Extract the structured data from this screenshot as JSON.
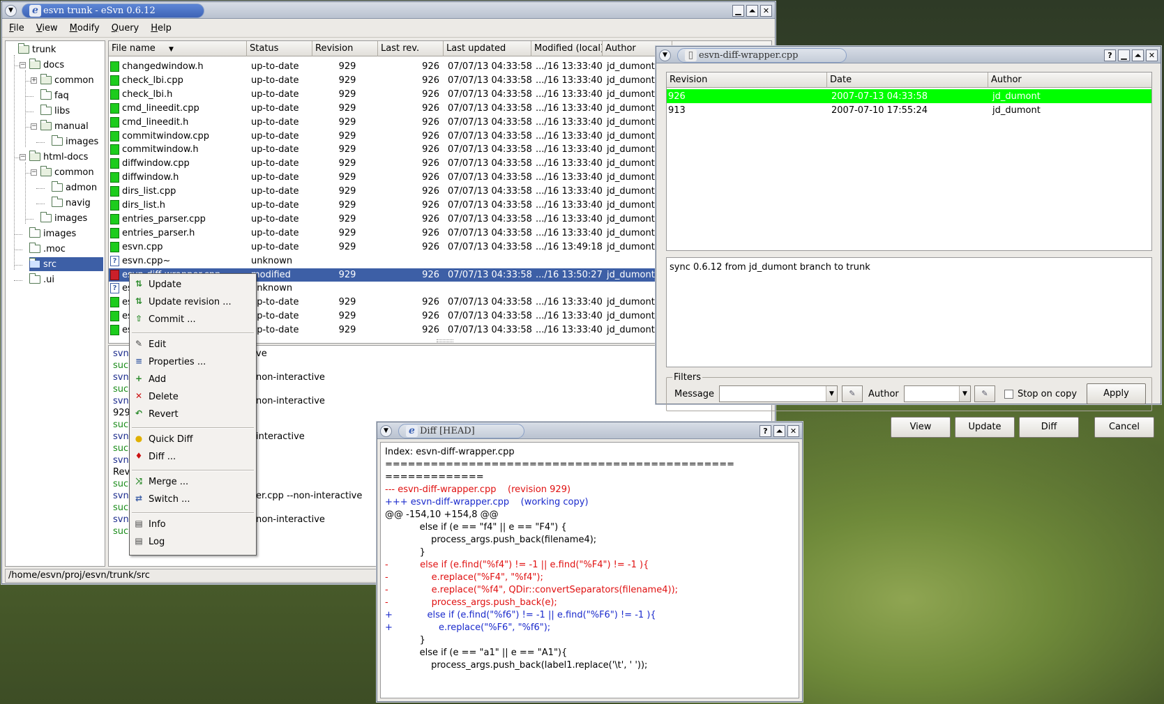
{
  "main_window": {
    "title": "esvn trunk - eSvn 0.6.12",
    "menu": [
      "File",
      "View",
      "Modify",
      "Query",
      "Help"
    ],
    "tree": [
      {
        "label": "trunk",
        "depth": 0
      },
      {
        "label": "docs",
        "depth": 1
      },
      {
        "label": "common",
        "depth": 2
      },
      {
        "label": "faq",
        "depth": 2
      },
      {
        "label": "libs",
        "depth": 2
      },
      {
        "label": "manual",
        "depth": 2
      },
      {
        "label": "images",
        "depth": 3
      },
      {
        "label": "html-docs",
        "depth": 1
      },
      {
        "label": "common",
        "depth": 2
      },
      {
        "label": "admon",
        "depth": 3
      },
      {
        "label": "navig",
        "depth": 3
      },
      {
        "label": "images",
        "depth": 2
      },
      {
        "label": "images",
        "depth": 1
      },
      {
        "label": ".moc",
        "depth": 1
      },
      {
        "label": "src",
        "depth": 1
      },
      {
        "label": ".ui",
        "depth": 1
      }
    ],
    "columns": [
      "File name",
      "Status",
      "Revision",
      "Last rev.",
      "Last updated",
      "Modified (local)",
      "Author"
    ],
    "files": [
      {
        "name": "changedwindow.h",
        "status": "up-to-date",
        "rev": "929",
        "last": "926",
        "upd": "07/07/13 04:33:58",
        "mod": ".../16 13:33:40",
        "author": "jd_dumont",
        "icon": "ok"
      },
      {
        "name": "check_lbi.cpp",
        "status": "up-to-date",
        "rev": "929",
        "last": "926",
        "upd": "07/07/13 04:33:58",
        "mod": ".../16 13:33:40",
        "author": "jd_dumont",
        "icon": "ok"
      },
      {
        "name": "check_lbi.h",
        "status": "up-to-date",
        "rev": "929",
        "last": "926",
        "upd": "07/07/13 04:33:58",
        "mod": ".../16 13:33:40",
        "author": "jd_dumont",
        "icon": "ok"
      },
      {
        "name": "cmd_lineedit.cpp",
        "status": "up-to-date",
        "rev": "929",
        "last": "926",
        "upd": "07/07/13 04:33:58",
        "mod": ".../16 13:33:40",
        "author": "jd_dumont",
        "icon": "ok"
      },
      {
        "name": "cmd_lineedit.h",
        "status": "up-to-date",
        "rev": "929",
        "last": "926",
        "upd": "07/07/13 04:33:58",
        "mod": ".../16 13:33:40",
        "author": "jd_dumont",
        "icon": "ok"
      },
      {
        "name": "commitwindow.cpp",
        "status": "up-to-date",
        "rev": "929",
        "last": "926",
        "upd": "07/07/13 04:33:58",
        "mod": ".../16 13:33:40",
        "author": "jd_dumont",
        "icon": "ok"
      },
      {
        "name": "commitwindow.h",
        "status": "up-to-date",
        "rev": "929",
        "last": "926",
        "upd": "07/07/13 04:33:58",
        "mod": ".../16 13:33:40",
        "author": "jd_dumont",
        "icon": "ok"
      },
      {
        "name": "diffwindow.cpp",
        "status": "up-to-date",
        "rev": "929",
        "last": "926",
        "upd": "07/07/13 04:33:58",
        "mod": ".../16 13:33:40",
        "author": "jd_dumont",
        "icon": "ok"
      },
      {
        "name": "diffwindow.h",
        "status": "up-to-date",
        "rev": "929",
        "last": "926",
        "upd": "07/07/13 04:33:58",
        "mod": ".../16 13:33:40",
        "author": "jd_dumont",
        "icon": "ok"
      },
      {
        "name": "dirs_list.cpp",
        "status": "up-to-date",
        "rev": "929",
        "last": "926",
        "upd": "07/07/13 04:33:58",
        "mod": ".../16 13:33:40",
        "author": "jd_dumont",
        "icon": "ok"
      },
      {
        "name": "dirs_list.h",
        "status": "up-to-date",
        "rev": "929",
        "last": "926",
        "upd": "07/07/13 04:33:58",
        "mod": ".../16 13:33:40",
        "author": "jd_dumont",
        "icon": "ok"
      },
      {
        "name": "entries_parser.cpp",
        "status": "up-to-date",
        "rev": "929",
        "last": "926",
        "upd": "07/07/13 04:33:58",
        "mod": ".../16 13:33:40",
        "author": "jd_dumont",
        "icon": "ok"
      },
      {
        "name": "entries_parser.h",
        "status": "up-to-date",
        "rev": "929",
        "last": "926",
        "upd": "07/07/13 04:33:58",
        "mod": ".../16 13:33:40",
        "author": "jd_dumont",
        "icon": "ok"
      },
      {
        "name": "esvn.cpp",
        "status": "up-to-date",
        "rev": "929",
        "last": "926",
        "upd": "07/07/13 04:33:58",
        "mod": ".../16 13:49:18",
        "author": "jd_dumont",
        "icon": "ok"
      },
      {
        "name": "esvn.cpp~",
        "status": "unknown",
        "rev": "",
        "last": "",
        "upd": "",
        "mod": "",
        "author": "",
        "icon": "unk"
      },
      {
        "name": "esvn-diff-wrapper.cpp",
        "status": "modified",
        "rev": "929",
        "last": "926",
        "upd": "07/07/13 04:33:58",
        "mod": ".../16 13:50:27",
        "author": "jd_dumont",
        "icon": "mod"
      },
      {
        "name": "esvn-diff-wrapper.cpp~",
        "status": "unknown",
        "rev": "",
        "last": "",
        "upd": "",
        "mod": "",
        "author": "",
        "icon": "unk"
      },
      {
        "name": "esvn.h",
        "status": "up-to-date",
        "rev": "929",
        "last": "926",
        "upd": "07/07/13 04:33:58",
        "mod": ".../16 13:33:40",
        "author": "jd_dumont",
        "icon": "ok"
      },
      {
        "name": "esvn.pro",
        "status": "up-to-date",
        "rev": "929",
        "last": "926",
        "upd": "07/07/13 04:33:58",
        "mod": ".../16 13:33:40",
        "author": "jd_dumont",
        "icon": "ok"
      },
      {
        "name": "esvn_utils.h",
        "status": "up-to-date",
        "rev": "929",
        "last": "926",
        "upd": "07/07/13 04:33:58",
        "mod": ".../16 13:33:40",
        "author": "jd_dumont",
        "icon": "ok"
      }
    ],
    "log_lines": [
      {
        "a": "svn",
        "b": "ve",
        "color": "#1a2a8c"
      },
      {
        "a": "succ",
        "b": "",
        "color": "#1a8c1a"
      },
      {
        "a": "svn",
        "b": "non-interactive",
        "color": "#1a2a8c"
      },
      {
        "a": "succ",
        "b": "",
        "color": "#1a8c1a"
      },
      {
        "a": "svn",
        "b": "non-interactive",
        "color": "#1a2a8c"
      },
      {
        "a": "929",
        "b": "",
        "color": "#000"
      },
      {
        "a": "succ",
        "b": "",
        "color": "#1a8c1a"
      },
      {
        "a": "svn",
        "b": "interactive",
        "color": "#1a2a8c"
      },
      {
        "a": "succ",
        "b": "",
        "color": "#1a8c1a"
      },
      {
        "a": "svn",
        "b": "",
        "color": "#1a2a8c"
      },
      {
        "a": "Rev",
        "b": "",
        "color": "#000"
      },
      {
        "a": "succ",
        "b": "",
        "color": "#1a8c1a"
      },
      {
        "a": "svn",
        "b": "er.cpp --non-interactive",
        "color": "#1a2a8c"
      },
      {
        "a": "succ",
        "b": "",
        "color": "#1a8c1a"
      },
      {
        "a": "svn",
        "b": "non-interactive",
        "color": "#1a2a8c"
      },
      {
        "a": "succ",
        "b": "",
        "color": "#1a8c1a"
      }
    ],
    "statusbar": "/home/esvn/proj/esvn/trunk/src"
  },
  "context_menu": [
    {
      "label": "Update",
      "icon": "update-icon",
      "sym": "⇅",
      "color": "#2a8a2a"
    },
    {
      "label": "Update revision ...",
      "icon": "update-revision-icon",
      "sym": "⇅",
      "color": "#2a8a2a"
    },
    {
      "label": "Commit ...",
      "icon": "commit-icon",
      "sym": "⇧",
      "color": "#2a8a2a"
    },
    {
      "sep": true
    },
    {
      "label": "Edit",
      "icon": "edit-icon",
      "sym": "✎",
      "color": "#444"
    },
    {
      "label": "Properties ...",
      "icon": "properties-icon",
      "sym": "≡",
      "color": "#3d5fa6"
    },
    {
      "label": "Add",
      "icon": "add-icon",
      "sym": "+",
      "color": "#2a8a2a"
    },
    {
      "label": "Delete",
      "icon": "delete-icon",
      "sym": "✕",
      "color": "#cc1111"
    },
    {
      "label": "Revert",
      "icon": "revert-icon",
      "sym": "↶",
      "color": "#2a8a2a"
    },
    {
      "sep": true
    },
    {
      "label": "Quick Diff",
      "icon": "lightbulb-icon",
      "sym": "●",
      "color": "#e0b000"
    },
    {
      "label": "Diff ...",
      "icon": "diff-icon",
      "sym": "♦",
      "color": "#cc1111"
    },
    {
      "sep": true
    },
    {
      "label": "Merge ...",
      "icon": "merge-icon",
      "sym": "⤨",
      "color": "#2a8a2a"
    },
    {
      "label": "Switch ...",
      "icon": "switch-icon",
      "sym": "⇄",
      "color": "#3d5fa6"
    },
    {
      "sep": true
    },
    {
      "label": "Info",
      "icon": "info-icon",
      "sym": "▤",
      "color": "#444"
    },
    {
      "label": "Log",
      "icon": "log-icon",
      "sym": "▤",
      "color": "#444"
    }
  ],
  "log_window": {
    "title": "esvn-diff-wrapper.cpp",
    "columns": [
      "Revision",
      "Date",
      "Author"
    ],
    "rows": [
      {
        "rev": "926",
        "date": "2007-07-13 04:33:58",
        "author": "jd_dumont"
      },
      {
        "rev": "913",
        "date": "2007-07-10 17:55:24",
        "author": "jd_dumont"
      }
    ],
    "message": "sync 0.6.12 from jd_dumont branch to trunk",
    "filters_label": "Filters",
    "message_label": "Message",
    "author_label": "Author",
    "stop_on_copy": "Stop on copy",
    "apply": "Apply",
    "buttons": [
      "View",
      "Update",
      "Diff",
      "Cancel"
    ]
  },
  "diff_window": {
    "title": "Diff [HEAD]",
    "lines": [
      {
        "t": "Index: esvn-diff-wrapper.cpp",
        "c": "#000"
      },
      {
        "t": "==============================================",
        "c": "#000"
      },
      {
        "t": "=============",
        "c": "#000"
      },
      {
        "t": "--- esvn-diff-wrapper.cpp    (revision 929)",
        "c": "#e01010"
      },
      {
        "t": "+++ esvn-diff-wrapper.cpp    (working copy)",
        "c": "#1a2acc"
      },
      {
        "t": "@@ -154,10 +154,8 @@",
        "c": "#000"
      },
      {
        "t": "            else if (e == \"f4\" || e == \"F4\") {",
        "c": "#000"
      },
      {
        "t": "                process_args.push_back(filename4);",
        "c": "#000"
      },
      {
        "t": "            }",
        "c": "#000"
      },
      {
        "t": "-           else if (e.find(\"%f4\") != -1 || e.find(\"%F4\") != -1 ){",
        "c": "#e01010"
      },
      {
        "t": "-               e.replace(\"%F4\", \"%f4\");",
        "c": "#e01010"
      },
      {
        "t": "-               e.replace(\"%f4\", QDir::convertSeparators(filename4));",
        "c": "#e01010"
      },
      {
        "t": "-               process_args.push_back(e);",
        "c": "#e01010"
      },
      {
        "t": "+            else if (e.find(\"%f6\") != -1 || e.find(\"%F6\") != -1 ){",
        "c": "#1a2acc"
      },
      {
        "t": "+                e.replace(\"%F6\", \"%f6\");",
        "c": "#1a2acc"
      },
      {
        "t": "            }",
        "c": "#000"
      },
      {
        "t": "            else if (e == \"a1\" || e == \"A1\"){",
        "c": "#000"
      },
      {
        "t": "                process_args.push_back(label1.replace('\\t', ' '));",
        "c": "#000"
      }
    ]
  },
  "colors": {
    "selection": "#3d5fa6",
    "log_highlight": "#00ff00",
    "uptodate_icon": "#1dcc1d",
    "modified_icon": "#cc1f2a"
  }
}
